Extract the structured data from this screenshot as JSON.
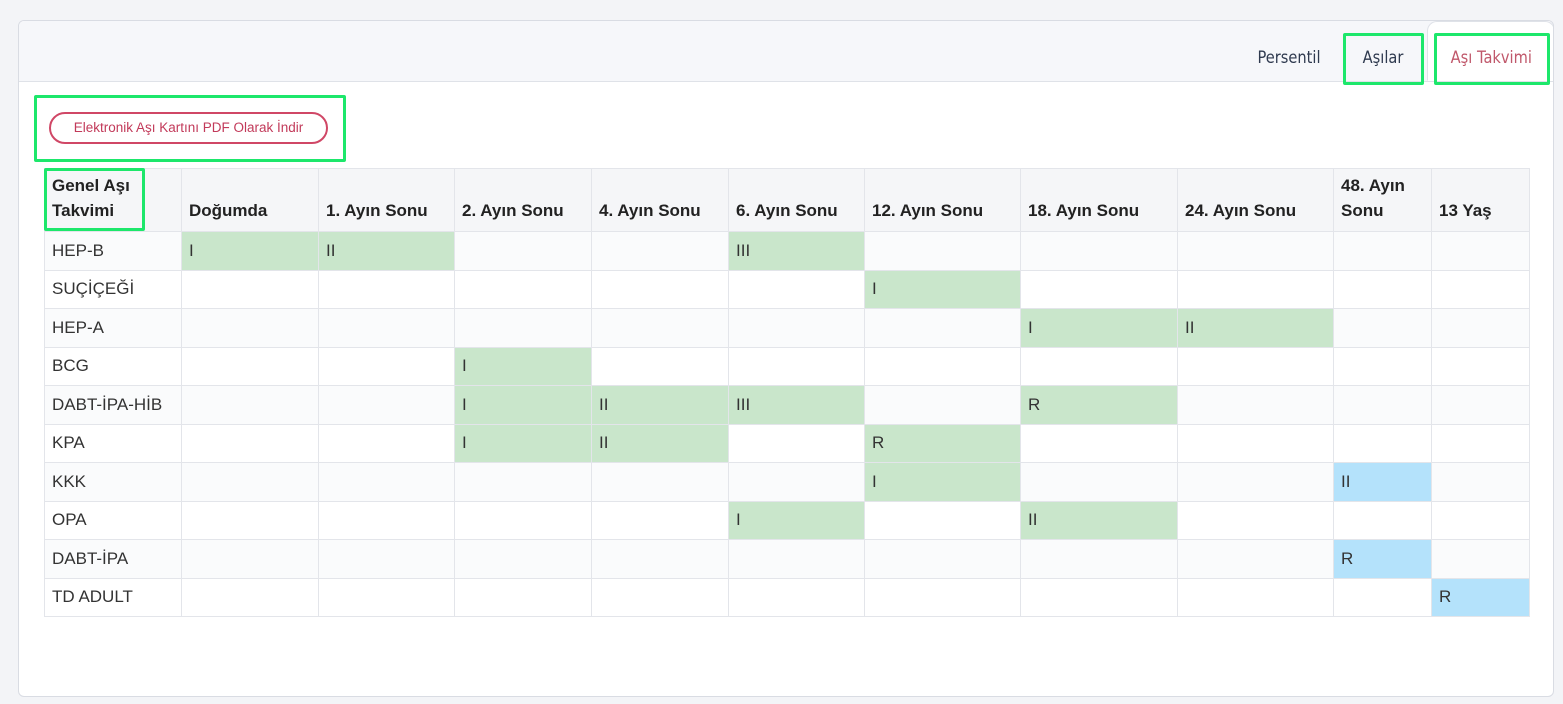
{
  "tabs": {
    "persentil": "Persentil",
    "asilar": "Aşılar",
    "asi_takvimi": "Aşı Takvimi"
  },
  "pdf_button": "Elektronik Aşı Kartını PDF Olarak İndir",
  "table": {
    "headers": [
      "Genel Aşı Takvimi",
      "Doğumda",
      "1. Ayın Sonu",
      "2. Ayın Sonu",
      "4. Ayın Sonu",
      "6. Ayın Sonu",
      "12. Ayın Sonu",
      "18. Ayın Sonu",
      "24. Ayın Sonu",
      "48. Ayın Sonu",
      "13 Yaş"
    ],
    "rows": [
      {
        "name": "HEP-B",
        "cells": [
          "I",
          "II",
          "",
          "",
          "III",
          "",
          "",
          "",
          "",
          ""
        ]
      },
      {
        "name": "SUÇİÇEĞİ",
        "cells": [
          "",
          "",
          "",
          "",
          "",
          "I",
          "",
          "",
          "",
          ""
        ]
      },
      {
        "name": "HEP-A",
        "cells": [
          "",
          "",
          "",
          "",
          "",
          "",
          "I",
          "II",
          "",
          ""
        ]
      },
      {
        "name": "BCG",
        "cells": [
          "",
          "",
          "I",
          "",
          "",
          "",
          "",
          "",
          "",
          ""
        ]
      },
      {
        "name": "DABT-İPA-HİB",
        "cells": [
          "",
          "",
          "I",
          "II",
          "III",
          "",
          "R",
          "",
          "",
          ""
        ]
      },
      {
        "name": "KPA",
        "cells": [
          "",
          "",
          "I",
          "II",
          "",
          "R",
          "",
          "",
          "",
          ""
        ]
      },
      {
        "name": "KKK",
        "cells": [
          "",
          "",
          "",
          "",
          "",
          "I",
          "",
          "",
          "II",
          ""
        ]
      },
      {
        "name": "OPA",
        "cells": [
          "",
          "",
          "",
          "",
          "I",
          "",
          "II",
          "",
          "",
          ""
        ]
      },
      {
        "name": "DABT-İPA",
        "cells": [
          "",
          "",
          "",
          "",
          "",
          "",
          "",
          "",
          "R",
          ""
        ]
      },
      {
        "name": "TD ADULT",
        "cells": [
          "",
          "",
          "",
          "",
          "",
          "",
          "",
          "",
          "",
          "R"
        ]
      }
    ],
    "shading": [
      [
        "g",
        "g",
        "",
        "",
        "g",
        "",
        "",
        "",
        "",
        ""
      ],
      [
        "",
        "",
        "",
        "",
        "",
        "g",
        "",
        "",
        "",
        ""
      ],
      [
        "",
        "",
        "",
        "",
        "",
        "",
        "g",
        "g",
        "",
        ""
      ],
      [
        "",
        "",
        "g",
        "",
        "",
        "",
        "",
        "",
        "",
        ""
      ],
      [
        "",
        "",
        "g",
        "g",
        "g",
        "",
        "g",
        "",
        "",
        ""
      ],
      [
        "",
        "",
        "g",
        "g",
        "",
        "g",
        "",
        "",
        "",
        ""
      ],
      [
        "",
        "",
        "",
        "",
        "",
        "g",
        "",
        "",
        "b",
        ""
      ],
      [
        "",
        "",
        "",
        "",
        "g",
        "",
        "g",
        "",
        "",
        ""
      ],
      [
        "",
        "",
        "",
        "",
        "",
        "",
        "",
        "",
        "b",
        ""
      ],
      [
        "",
        "",
        "",
        "",
        "",
        "",
        "",
        "",
        "",
        "b"
      ]
    ]
  },
  "colors": {
    "done_green": "#c9e6cb",
    "planned_blue": "#b4e2fb",
    "highlight": "#1de76b",
    "accent": "#c0586b"
  }
}
